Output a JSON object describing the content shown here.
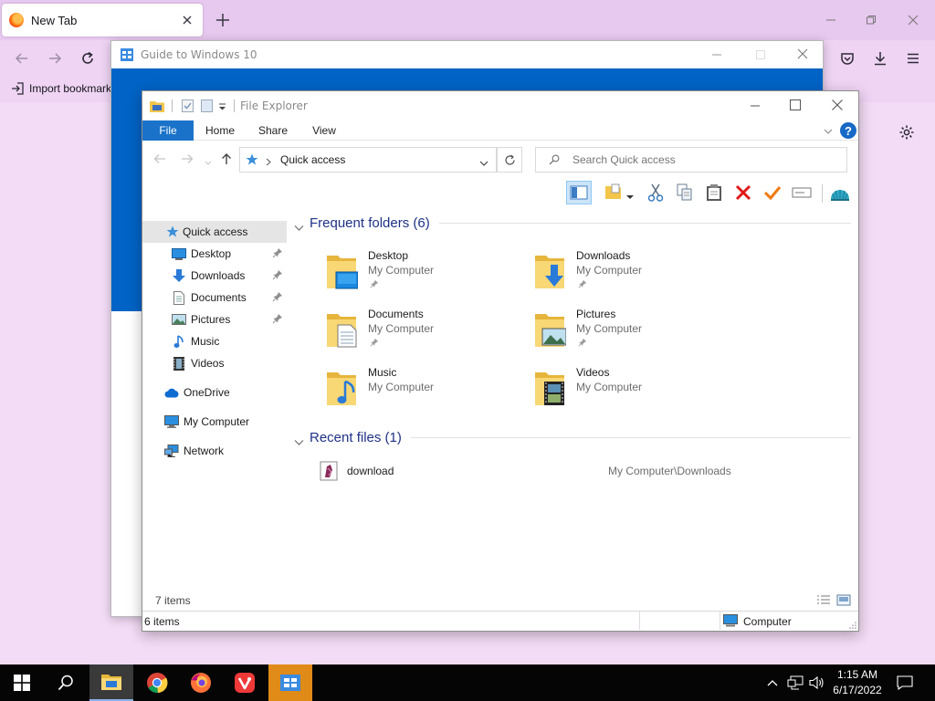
{
  "firefox": {
    "tab": {
      "title": "New Tab"
    },
    "bookmarks": {
      "import_label": "Import bookmarks..."
    }
  },
  "guide_window": {
    "title": "Guide to Windows 10"
  },
  "explorer": {
    "title": "File Explorer",
    "ribbon_tabs": [
      "File",
      "Home",
      "Share",
      "View"
    ],
    "address": {
      "location": "Quick access"
    },
    "search": {
      "placeholder": "Search Quick access"
    },
    "nav": {
      "quick_access": "Quick access",
      "desktop": "Desktop",
      "downloads": "Downloads",
      "documents": "Documents",
      "pictures": "Pictures",
      "music": "Music",
      "videos": "Videos",
      "onedrive": "OneDrive",
      "my_computer": "My Computer",
      "network": "Network"
    },
    "frequent": {
      "header": "Frequent folders (6)",
      "location": "My Computer",
      "folders": [
        "Desktop",
        "Downloads",
        "Documents",
        "Pictures",
        "Music",
        "Videos"
      ]
    },
    "recent": {
      "header": "Recent files (1)",
      "file_name": "download",
      "file_path": "My Computer\\Downloads"
    },
    "inner_status": "7 items",
    "status": {
      "items": "6 items",
      "zone": "Computer"
    }
  },
  "taskbar": {
    "time": "1:15 AM",
    "date": "6/17/2022"
  },
  "colors": {
    "accent": "#0063c5",
    "ribbon_file": "#1a73c9",
    "taskbar": "#050505",
    "firefox_frame": "#e7c8ef"
  }
}
